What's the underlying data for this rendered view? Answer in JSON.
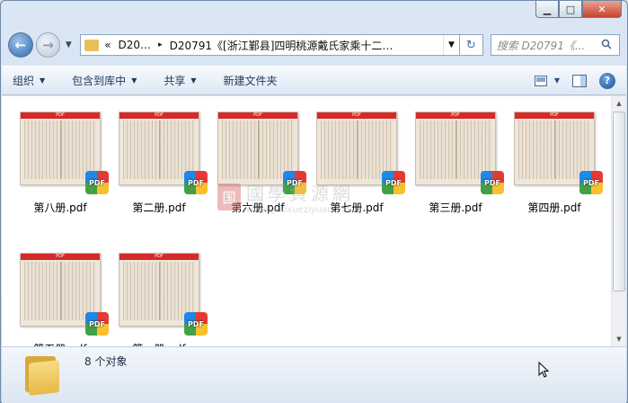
{
  "window": {
    "minimize_glyph": "▁",
    "maximize_glyph": "□",
    "close_glyph": "✕"
  },
  "nav": {
    "back_glyph": "←",
    "forward_glyph": "→",
    "history_drop_glyph": "▼",
    "address": {
      "overflow": "«",
      "crumb1": "D20…",
      "separator": "▸",
      "crumb2": "D20791《[浙江鄞县]四明桃源戴氏家乘十二…",
      "drop_glyph": "▼"
    },
    "refresh_glyph": "↻",
    "search_placeholder": "搜索 D20791《...",
    "search_icon": "search-icon"
  },
  "toolbar": {
    "organize": "组织",
    "include_library": "包含到库中",
    "share": "共享",
    "new_folder": "新建文件夹",
    "dropdown_glyph": "▼",
    "view_icon": "view-options-icon",
    "preview_pane_icon": "preview-pane-icon",
    "help_glyph": "?"
  },
  "files": [
    {
      "name": "第八册.pdf",
      "badge": "PDF",
      "header": "PDF"
    },
    {
      "name": "第二册.pdf",
      "badge": "PDF",
      "header": "PDF"
    },
    {
      "name": "第六册.pdf",
      "badge": "PDF",
      "header": "PDF"
    },
    {
      "name": "第七册.pdf",
      "badge": "PDF",
      "header": "PDF"
    },
    {
      "name": "第三册.pdf",
      "badge": "PDF",
      "header": "PDF"
    },
    {
      "name": "第四册.pdf",
      "badge": "PDF",
      "header": "PDF"
    },
    {
      "name": "第五册.pdf",
      "badge": "PDF",
      "header": "PDF"
    },
    {
      "name": "第一册.pdf",
      "badge": "PDF",
      "header": "PDF"
    }
  ],
  "watermark": {
    "seal": "国",
    "text": "國學資源網",
    "url": "www.guoxueziyuan.net"
  },
  "status": {
    "count_text": "8 个对象"
  },
  "scrollbar": {
    "up_glyph": "▲",
    "down_glyph": "▼"
  }
}
